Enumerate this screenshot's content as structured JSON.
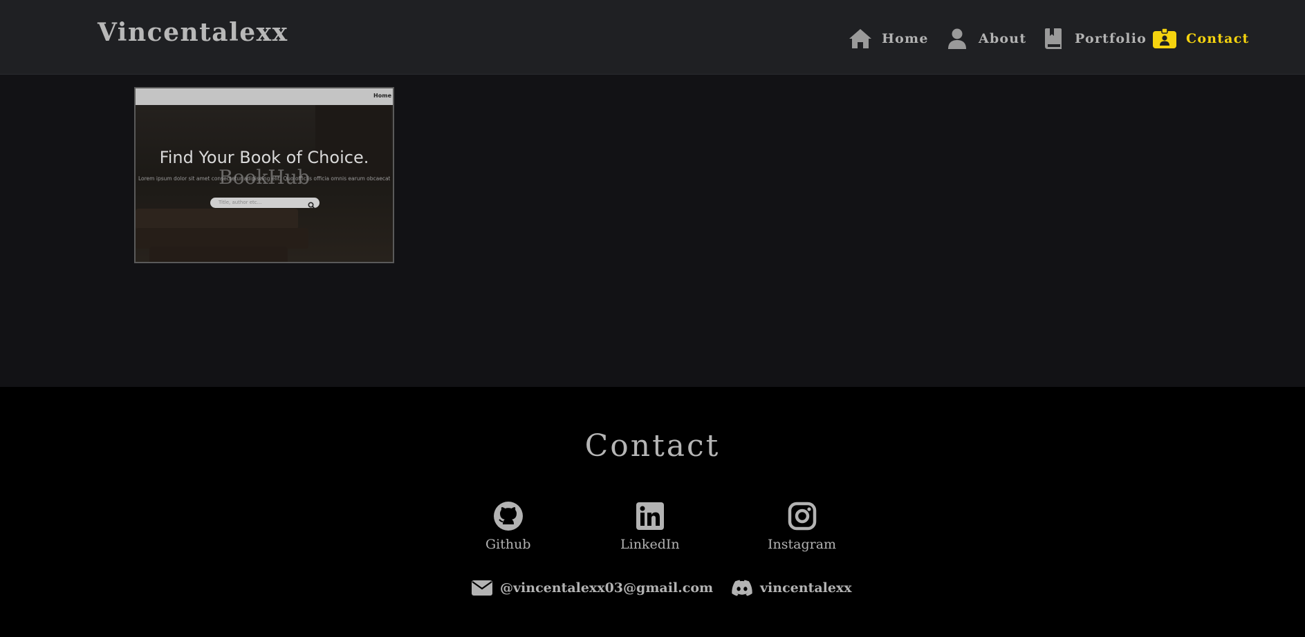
{
  "brand": {
    "title": "Vincentalexx"
  },
  "nav": {
    "items": [
      {
        "label": "Home",
        "icon": "home-icon",
        "active": false
      },
      {
        "label": "About",
        "icon": "user-icon",
        "active": false
      },
      {
        "label": "Portfolio",
        "icon": "book-icon",
        "active": false
      },
      {
        "label": "Contact",
        "icon": "id-badge-icon",
        "active": true
      }
    ],
    "active_color": "#f5d30f",
    "inactive_color": "#b3b3b3"
  },
  "portfolio": {
    "project": {
      "nav_text": "Home",
      "headline": "Find Your Book of Choice.",
      "subtext": "Lorem ipsum dolor sit amet consectetur adipiscing elit. Quo officiis officia omnis earum obcaecati, id eligendi non molestiae velit. Nihil, blanditiis inventore",
      "search_placeholder": "Title, author etc...",
      "overlay_label": "BookHub"
    }
  },
  "contact": {
    "title": "Contact",
    "socials": [
      {
        "label": "Github",
        "icon": "github-icon"
      },
      {
        "label": "LinkedIn",
        "icon": "linkedin-icon"
      },
      {
        "label": "Instagram",
        "icon": "instagram-icon"
      }
    ],
    "email": {
      "text": "@vincentalexx03@gmail.com",
      "icon": "envelope-icon"
    },
    "discord": {
      "text": "vincentalexx",
      "icon": "discord-icon"
    }
  },
  "colors": {
    "header_bg": "#1f2023",
    "main_bg": "#121215",
    "footer_bg": "#000000",
    "text": "#b3b3b3"
  }
}
